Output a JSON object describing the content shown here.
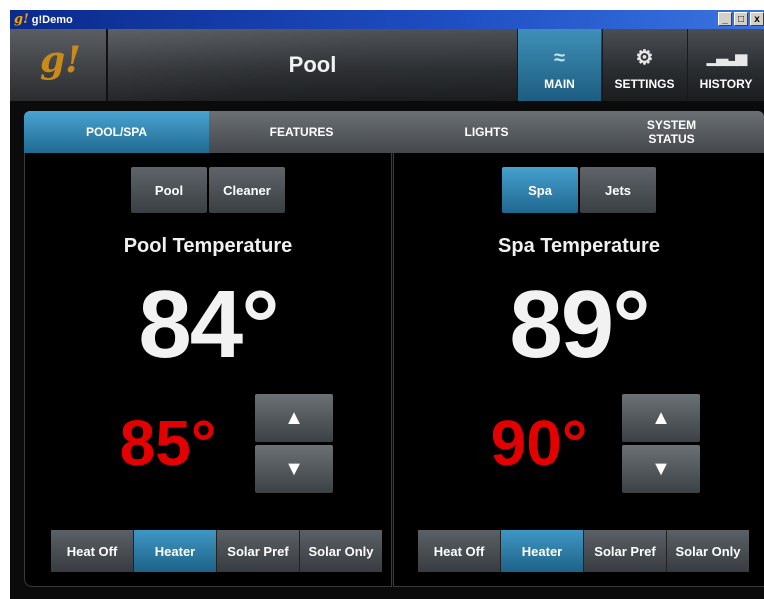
{
  "window": {
    "title": "g!Demo",
    "logo": "g!",
    "controls": [
      "_",
      "□",
      "x"
    ]
  },
  "header": {
    "logo": "g!",
    "title": "Pool",
    "nav": [
      {
        "label": "MAIN",
        "icon": "pool-water-icon",
        "glyph": "≈",
        "active": true
      },
      {
        "label": "SETTINGS",
        "icon": "gear-icon",
        "glyph": "⚙",
        "active": false
      },
      {
        "label": "HISTORY",
        "icon": "bar-chart-icon",
        "glyph": "▁▃▂▅",
        "active": false
      }
    ]
  },
  "tabs": [
    {
      "label": "POOL/SPA",
      "active": true
    },
    {
      "label": "FEATURES",
      "active": false
    },
    {
      "label": "LIGHTS",
      "active": false
    },
    {
      "label": "SYSTEM\nSTATUS",
      "active": false
    }
  ],
  "pool": {
    "buttons": [
      {
        "label": "Pool",
        "active": false
      },
      {
        "label": "Cleaner",
        "active": false
      }
    ],
    "temp_label": "Pool Temperature",
    "current_temp": "84°",
    "set_temp": "85°",
    "heat_modes": [
      {
        "label": "Heat Off",
        "active": false
      },
      {
        "label": "Heater",
        "active": true
      },
      {
        "label": "Solar Pref",
        "active": false
      },
      {
        "label": "Solar Only",
        "active": false
      }
    ]
  },
  "spa": {
    "buttons": [
      {
        "label": "Spa",
        "active": true
      },
      {
        "label": "Jets",
        "active": false
      }
    ],
    "temp_label": "Spa Temperature",
    "current_temp": "89°",
    "set_temp": "90°",
    "heat_modes": [
      {
        "label": "Heat Off",
        "active": false
      },
      {
        "label": "Heater",
        "active": true
      },
      {
        "label": "Solar Pref",
        "active": false
      },
      {
        "label": "Solar Only",
        "active": false
      }
    ]
  },
  "icons": {
    "up": "▲",
    "down": "▼"
  },
  "colors": {
    "accent": "#2a7fae",
    "setpoint": "#e30000",
    "logo": "#c98a1a"
  }
}
